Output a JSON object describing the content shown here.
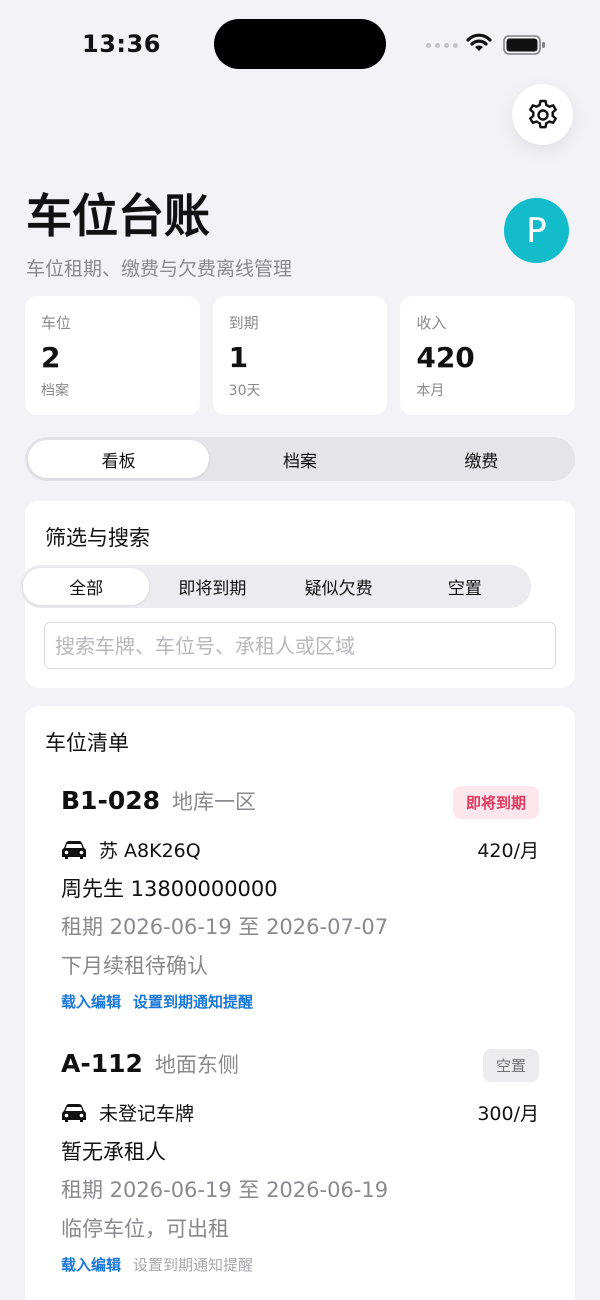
{
  "status_bar": {
    "time": "13:36"
  },
  "header": {
    "title": "车位台账",
    "subtitle": "车位租期、缴费与欠费离线管理",
    "avatar_letter": "P"
  },
  "stats": [
    {
      "label": "车位",
      "value": "2",
      "sub": "档案"
    },
    {
      "label": "到期",
      "value": "1",
      "sub": "30天"
    },
    {
      "label": "收入",
      "value": "420",
      "sub": "本月"
    }
  ],
  "tabs": [
    "看板",
    "档案",
    "缴费"
  ],
  "filter": {
    "title": "筛选与搜索",
    "options": [
      "全部",
      "即将到期",
      "疑似欠费",
      "空置"
    ],
    "search_placeholder": "搜索车牌、车位号、承租人或区域"
  },
  "list": {
    "title": "车位清单",
    "items": [
      {
        "code": "B1-028",
        "zone": "地库一区",
        "status": "即将到期",
        "plate": "苏 A8K26Q",
        "rent": "420/月",
        "tenant": "周先生  13800000000",
        "lease": "租期 2026-06-19 至 2026-07-07",
        "note": "下月续租待确认",
        "action_edit": "载入编辑",
        "action_remind": "设置到期通知提醒"
      },
      {
        "code": "A-112",
        "zone": "地面东侧",
        "status": "空置",
        "plate": "未登记车牌",
        "rent": "300/月",
        "tenant": "暂无承租人",
        "lease": "租期 2026-06-19 至 2026-06-19",
        "note": "临停车位，可出租",
        "action_edit": "载入编辑",
        "action_remind": "设置到期通知提醒"
      }
    ]
  },
  "colors": {
    "accent": "#1a78d6",
    "avatar": "#12bccb",
    "warn": "#e0395f",
    "background": "#f2f2f7"
  }
}
